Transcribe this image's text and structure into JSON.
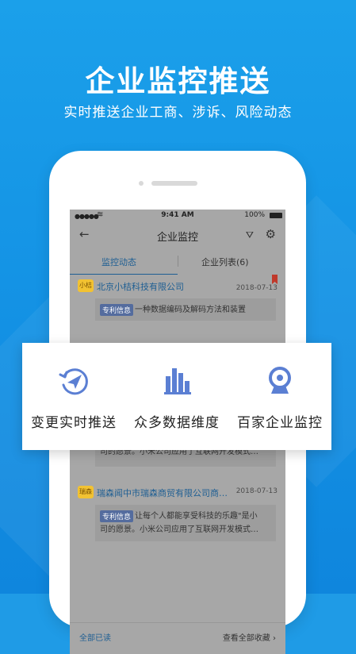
{
  "header": {
    "title": "企业监控推送",
    "subtitle": "实时推送企业工商、涉诉、风险动态"
  },
  "status_bar": {
    "time": "9:41 AM",
    "battery": "100%",
    "signal_icon": "signal-dots-icon",
    "wifi_icon": "wifi-icon",
    "battery_icon": "battery-icon"
  },
  "navbar": {
    "title": "企业监控",
    "back_icon": "arrow-left-icon",
    "filter_icon": "filter-icon",
    "settings_icon": "gear-icon"
  },
  "tabs": [
    {
      "label": "监控动态",
      "active": true
    },
    {
      "label": "企业列表(6)",
      "active": false
    }
  ],
  "cards": [
    {
      "logo_text": "小桔",
      "company": "北京小桔科技有限公司",
      "date": "2018-07-13",
      "bookmarked": true,
      "badge": "专利信息",
      "text": "一种数据编码及解码方法和装置"
    },
    {
      "partial_text_1": "司的愿景。小米公司应用了互联网开发模式…"
    },
    {
      "logo_text": "瑞森",
      "company": "瑞森闻中市瑞森商贸有限公司商…",
      "date": "2018-07-13",
      "badge": "专利信息",
      "text_line1": "让每个人都能享受科技的乐趣\"是小",
      "text_line2": "司的愿景。小米公司应用了互联网开发模式…"
    }
  ],
  "footer": {
    "left": "全部已读",
    "right": "查看全部收藏",
    "chevron_icon": "chevron-right-icon"
  },
  "features": [
    {
      "label": "变更实时推送",
      "icon": "send-refresh-icon"
    },
    {
      "label": "众多数据维度",
      "icon": "bar-chart-icon"
    },
    {
      "label": "百家企业监控",
      "icon": "webcam-icon"
    }
  ],
  "colors": {
    "background": "#1391e4",
    "accent": "#1f5f93",
    "icon": "#5b7fd3",
    "badge": "#546c9e",
    "bookmark": "#c0392b"
  }
}
